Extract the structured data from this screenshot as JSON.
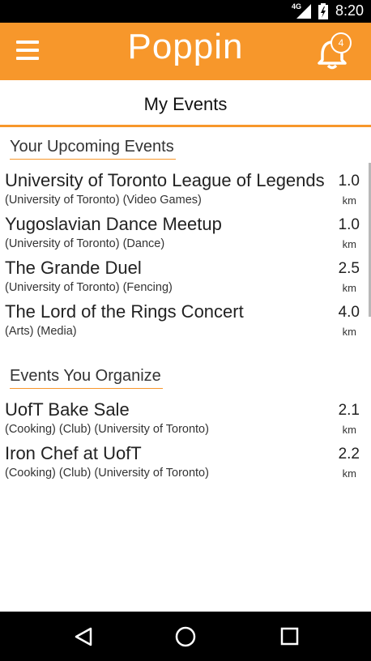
{
  "status_bar": {
    "network": "4G",
    "time": "8:20"
  },
  "app_bar": {
    "title": "Poppin",
    "notification_count": "4"
  },
  "page": {
    "title": "My Events"
  },
  "upcoming": {
    "title": "Your Upcoming Events",
    "events": [
      {
        "name": "University of Toronto League of Legends",
        "tags": "(University of Toronto) (Video Games)",
        "distance": "1.0",
        "unit": "km"
      },
      {
        "name": "Yugoslavian Dance Meetup",
        "tags": "(University of Toronto) (Dance)",
        "distance": "1.0",
        "unit": "km"
      },
      {
        "name": "The Grande Duel",
        "tags": "(University of Toronto) (Fencing)",
        "distance": "2.5",
        "unit": "km"
      },
      {
        "name": "The Lord of the Rings Concert",
        "tags": "(Arts) (Media)",
        "distance": "4.0",
        "unit": "km"
      }
    ]
  },
  "organize": {
    "title": "Events You Organize",
    "events": [
      {
        "name": "UofT Bake Sale",
        "tags": "(Cooking) (Club) (University of Toronto)",
        "distance": "2.1",
        "unit": "km"
      },
      {
        "name": "Iron Chef at UofT",
        "tags": "(Cooking) (Club) (University of Toronto)",
        "distance": "2.2",
        "unit": "km"
      }
    ]
  },
  "colors": {
    "accent": "#f7972b",
    "status_bar": "#000000",
    "nav_bar": "#000000"
  },
  "icons": {
    "menu": "hamburger-icon",
    "notifications": "bell-icon",
    "back": "back-triangle-icon",
    "home": "home-circle-icon",
    "recent": "recent-apps-square-icon"
  }
}
